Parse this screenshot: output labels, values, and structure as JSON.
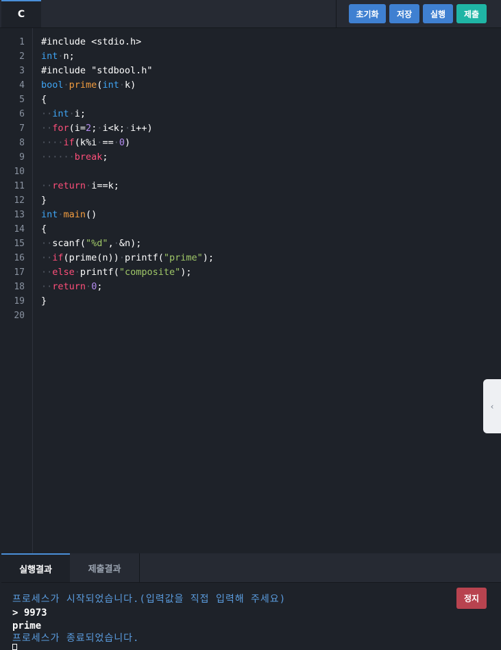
{
  "toolbar": {
    "language_tab": "C",
    "buttons": {
      "reset": "초기화",
      "save": "저장",
      "run": "실행",
      "submit": "제출"
    }
  },
  "editor": {
    "line_numbers": [
      "1",
      "2",
      "3",
      "4",
      "5",
      "6",
      "7",
      "8",
      "9",
      "10",
      "11",
      "12",
      "13",
      "14",
      "15",
      "16",
      "17",
      "18",
      "19",
      "20"
    ],
    "lines": [
      "#include <stdio.h>",
      "int n;",
      "#include \"stdbool.h\"",
      "bool prime(int k)",
      "{",
      "  int i;",
      "  for(i=2; i<k; i++)",
      "    if(k%i == 0)",
      "      break;",
      "",
      "  return i==k;",
      "}",
      "int main()",
      "{",
      "  scanf(\"%d\", &n);",
      "  if(prime(n)) printf(\"prime\");",
      "  else printf(\"composite\");",
      "  return 0;",
      "}",
      ""
    ],
    "panel_toggle_icon": "chevron-left-icon",
    "panel_toggle_glyph": "‹"
  },
  "output_panel": {
    "tabs": {
      "run_result": "실행결과",
      "submit_result": "제출결과"
    },
    "stop_button": "정지",
    "console": {
      "start_message": "프로세스가 시작되었습니다.(입력값을 직접 입력해 주세요)",
      "input_line": "> 9973",
      "output_line": "prime",
      "end_message": "프로세스가 종료되었습니다."
    }
  },
  "colors": {
    "background": "#1e2229",
    "button_blue": "#3f80d1",
    "button_teal": "#1fb5a5",
    "stop_red": "#b8434f",
    "keyword": "#3fa5f5",
    "function": "#f29c3f",
    "string": "#a0c868",
    "control": "#ff4f7a",
    "number": "#b48cf0"
  }
}
